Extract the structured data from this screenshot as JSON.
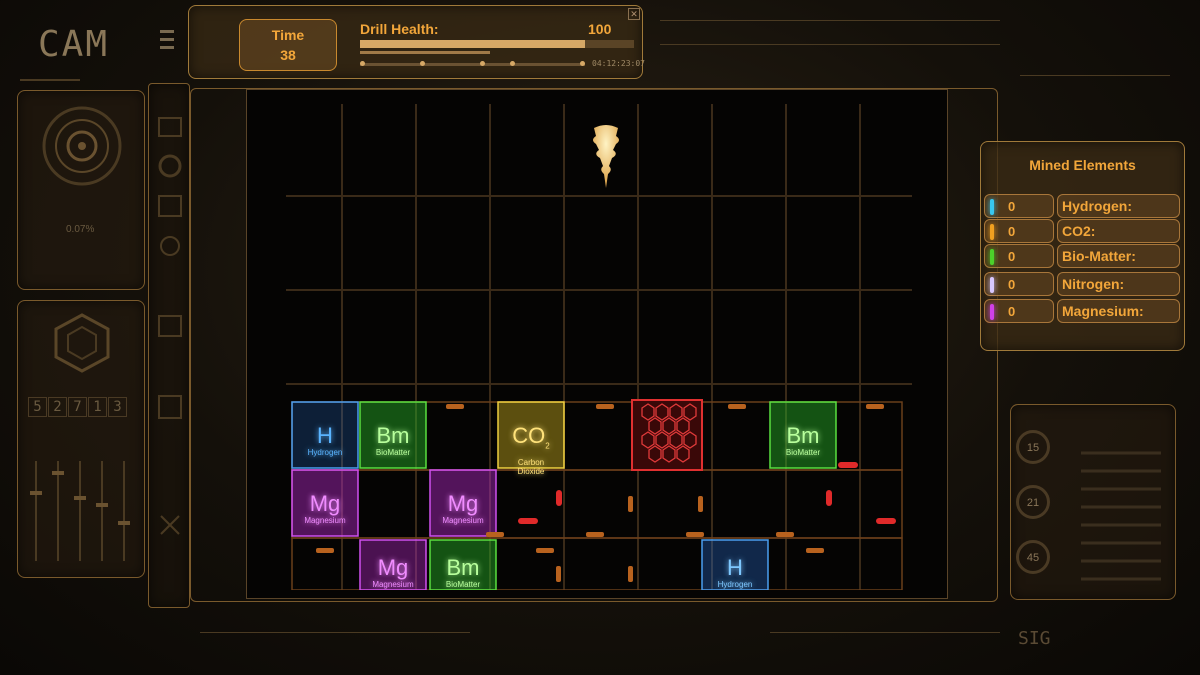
{
  "brand": "CAM",
  "hud": {
    "time_label": "Time",
    "time_value": "38",
    "drill_health_label": "Drill Health:",
    "drill_health_value": "100",
    "drill_health_fraction": 0.82,
    "timestamp": "04:12:23:07"
  },
  "mined": {
    "title": "Mined Elements",
    "items": [
      {
        "label": "Hydrogen:",
        "count": "0",
        "color": "#38c8f0"
      },
      {
        "label": "CO2:",
        "count": "0",
        "color": "#f0a020"
      },
      {
        "label": "Bio-Matter:",
        "count": "0",
        "color": "#4cd22a"
      },
      {
        "label": "Nitrogen:",
        "count": "0",
        "color": "#d8c8ff"
      },
      {
        "label": "Magnesium:",
        "count": "0",
        "color": "#d040e8"
      }
    ]
  },
  "tiles": [
    {
      "sym": "H",
      "name": "Hydrogen",
      "color": "#5ab4ff"
    },
    {
      "sym": "Bm",
      "name": "BioMatter",
      "color": "#b8ff9c"
    },
    {
      "sym": "CO",
      "sub": "2",
      "name": "Carbon Dioxide",
      "color": "#ffe27a"
    },
    {
      "sym": "Bm",
      "name": "BioMatter",
      "color": "#b8ff9c"
    },
    {
      "sym": "Mg",
      "name": "Magnesium",
      "color": "#f08cff"
    },
    {
      "sym": "Mg",
      "name": "Magnesium",
      "color": "#f08cff"
    },
    {
      "sym": "Mg",
      "name": "Magnesium",
      "color": "#f08cff"
    },
    {
      "sym": "Bm",
      "name": "BioMatter",
      "color": "#b8ff9c"
    },
    {
      "sym": "H",
      "name": "Hydrogen",
      "color": "#7ec8ff"
    }
  ],
  "side": {
    "percent": "0.07%",
    "digits": [
      "5",
      "2",
      "7",
      "1",
      "3"
    ],
    "gauges": [
      "15",
      "21",
      "45"
    ],
    "sig": "SIG"
  }
}
